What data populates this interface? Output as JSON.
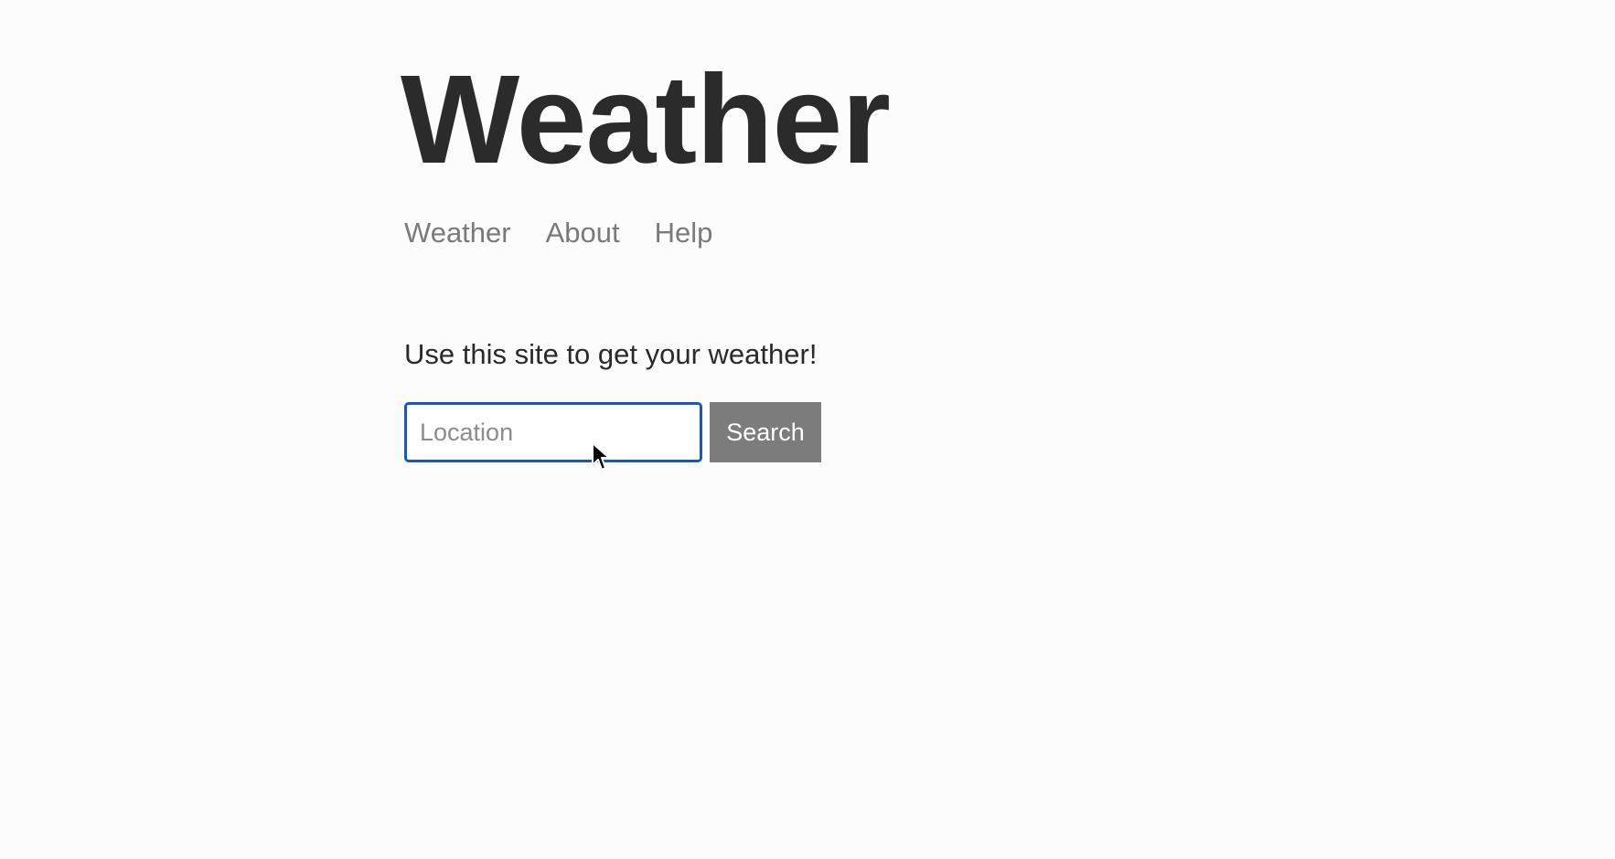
{
  "header": {
    "title": "Weather"
  },
  "nav": {
    "items": [
      {
        "label": "Weather"
      },
      {
        "label": "About"
      },
      {
        "label": "Help"
      }
    ]
  },
  "main": {
    "intro_text": "Use this site to get your weather!",
    "search": {
      "value": "",
      "placeholder": "Location",
      "button_label": "Search"
    }
  },
  "colors": {
    "input_focus_border": "#1a56c0",
    "button_background": "#7c7c7c",
    "nav_link": "#7a7a7a"
  },
  "icons": {
    "pointer": "mouse-pointer-icon"
  }
}
